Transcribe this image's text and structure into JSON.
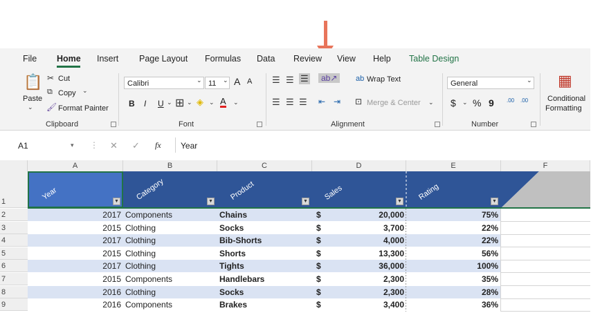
{
  "menu": [
    "File",
    "Home",
    "Insert",
    "Page Layout",
    "Formulas",
    "Data",
    "Review",
    "View",
    "Help",
    "Table Design"
  ],
  "clipboard": {
    "paste": "Paste",
    "cut": "Cut",
    "copy": "Copy",
    "format_painter": "Format Painter",
    "label": "Clipboard"
  },
  "font": {
    "name": "Calibri",
    "size": "11",
    "bold": "B",
    "italic": "I",
    "underline": "U",
    "label": "Font",
    "grow": "A",
    "shrink": "A"
  },
  "alignment": {
    "wrap_text": "Wrap Text",
    "merge_center": "Merge & Center",
    "label": "Alignment"
  },
  "number": {
    "format": "General",
    "currency": "$",
    "percent": "%",
    "comma": "9",
    "label": "Number",
    "inc_decimal": ".00",
    "dec_decimal": ".00"
  },
  "styles": {
    "conditional": "Conditional",
    "formatting": "Formatting"
  },
  "formula_bar": {
    "name_box": "A1",
    "fx": "fx",
    "value": "Year"
  },
  "columns": [
    "A",
    "B",
    "C",
    "D",
    "E",
    "F"
  ],
  "headers": [
    "Year",
    "Category",
    "Product",
    "Sales",
    "Rating"
  ],
  "rows": [
    {
      "num": "2",
      "year": "2017",
      "category": "Components",
      "product": "Chains",
      "cur": "$",
      "sales": "20,000",
      "rating": "75%"
    },
    {
      "num": "3",
      "year": "2015",
      "category": "Clothing",
      "product": "Socks",
      "cur": "$",
      "sales": "3,700",
      "rating": "22%"
    },
    {
      "num": "4",
      "year": "2017",
      "category": "Clothing",
      "product": "Bib-Shorts",
      "cur": "$",
      "sales": "4,000",
      "rating": "22%"
    },
    {
      "num": "5",
      "year": "2015",
      "category": "Clothing",
      "product": "Shorts",
      "cur": "$",
      "sales": "13,300",
      "rating": "56%"
    },
    {
      "num": "6",
      "year": "2017",
      "category": "Clothing",
      "product": "Tights",
      "cur": "$",
      "sales": "36,000",
      "rating": "100%"
    },
    {
      "num": "7",
      "year": "2015",
      "category": "Components",
      "product": "Handlebars",
      "cur": "$",
      "sales": "2,300",
      "rating": "35%"
    },
    {
      "num": "8",
      "year": "2016",
      "category": "Clothing",
      "product": "Socks",
      "cur": "$",
      "sales": "2,300",
      "rating": "28%"
    },
    {
      "num": "9",
      "year": "2016",
      "category": "Components",
      "product": "Brakes",
      "cur": "$",
      "sales": "3,400",
      "rating": "36%"
    }
  ],
  "header_row_num": "1",
  "colors": {
    "accent": "#217346",
    "header_fill": "#2f5597",
    "band": "#dae3f3",
    "arrow": "#e8755b"
  }
}
